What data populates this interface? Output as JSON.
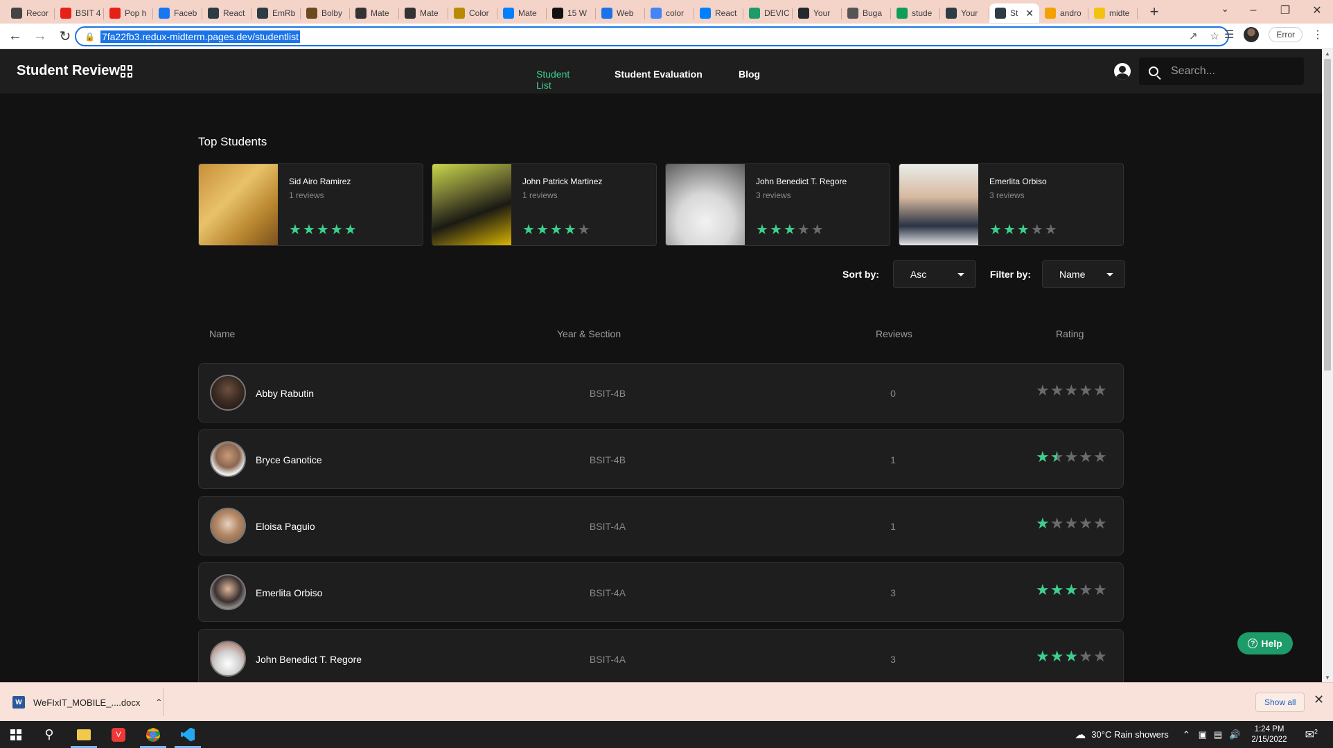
{
  "browser": {
    "tabs": [
      {
        "label": "Recor",
        "color": "#444"
      },
      {
        "label": "BSIT 4",
        "color": "#e62117"
      },
      {
        "label": "Pop h",
        "color": "#e62117"
      },
      {
        "label": "Faceb",
        "color": "#1877f2"
      },
      {
        "label": "React",
        "color": "#2d3b45"
      },
      {
        "label": "EmRb",
        "color": "#2d3b45"
      },
      {
        "label": "Bolby",
        "color": "#6b4a1e"
      },
      {
        "label": "Mate",
        "color": "#333"
      },
      {
        "label": "Mate",
        "color": "#333"
      },
      {
        "label": "Color",
        "color": "#b88a00"
      },
      {
        "label": "Mate",
        "color": "#007fff"
      },
      {
        "label": "15 W",
        "color": "#111"
      },
      {
        "label": "Web",
        "color": "#1a73e8"
      },
      {
        "label": "color",
        "color": "#4285f4"
      },
      {
        "label": "React",
        "color": "#007fff"
      },
      {
        "label": "DEVIC",
        "color": "#1d9c6a"
      },
      {
        "label": "Your",
        "color": "#24292e"
      },
      {
        "label": "Buga",
        "color": "#555"
      },
      {
        "label": "stude",
        "color": "#0f9d58"
      },
      {
        "label": "Your",
        "color": "#2d3b45"
      },
      {
        "label": "St",
        "color": "#2d3b45",
        "active": true
      },
      {
        "label": "andro",
        "color": "#f4a100"
      },
      {
        "label": "midte",
        "color": "#f4c20d"
      }
    ],
    "url": "7fa22fb3.redux-midterm.pages.dev/studentlist",
    "error_label": "Error"
  },
  "header": {
    "brand": "Student Review",
    "nav": [
      {
        "label": "Student List",
        "active": true
      },
      {
        "label": "Student Evaluation"
      },
      {
        "label": "Blog"
      }
    ],
    "search_placeholder": "Search..."
  },
  "top_students": {
    "title": "Top Students",
    "items": [
      {
        "name": "Sid Airo Ramirez",
        "reviews": "1 reviews",
        "rating": 5,
        "photo": "linear-gradient(135deg,#c98f3a 0%,#e8c26a 40%,#b9872f 70%,#7a4f1e 100%)"
      },
      {
        "name": "John Patrick Martinez",
        "reviews": "1 reviews",
        "rating": 4,
        "photo": "linear-gradient(160deg,#c8d84a 0%,#6a6a30 35%,#1a1a14 60%,#e0b800 100%)"
      },
      {
        "name": "John Benedict T. Regore",
        "reviews": "3 reviews",
        "rating": 3,
        "photo": "radial-gradient(circle at 50% 70%,#f2f2f2 0%,#d8d8d8 40%,#9a9a9a 70%,#5c5c5c 100%)"
      },
      {
        "name": "Emerlita Orbiso",
        "reviews": "3 reviews",
        "rating": 3,
        "photo": "linear-gradient(180deg,#e8ece8 0%,#d7b9a0 40%,#2a3344 75%,#f0f0f0 100%)"
      }
    ]
  },
  "controls": {
    "sort_label": "Sort by:",
    "sort_value": "Asc",
    "filter_label": "Filter by:",
    "filter_value": "Name"
  },
  "table": {
    "headers": {
      "name": "Name",
      "section": "Year & Section",
      "reviews": "Reviews",
      "rating": "Rating"
    },
    "rows": [
      {
        "name": "Abby Rabutin",
        "section": "BSIT-4B",
        "reviews": "0",
        "rating": 0,
        "photo": "radial-gradient(circle at 50% 40%,#6e5040 0%,#3a2a22 50%,#1a1410 100%)"
      },
      {
        "name": "Bryce Ganotice",
        "section": "BSIT-4B",
        "reviews": "1",
        "rating": 1.5,
        "photo": "radial-gradient(circle at 50% 40%,#c99a7a 0%,#8a6650 45%,#e8e8e8 70%)"
      },
      {
        "name": "Eloisa Paguio",
        "section": "BSIT-4A",
        "reviews": "1",
        "rating": 1,
        "photo": "radial-gradient(circle at 50% 45%,#e8d2c0 0%,#b48866 45%,#7a5a40 100%)"
      },
      {
        "name": "Emerlita Orbiso",
        "section": "BSIT-4A",
        "reviews": "3",
        "rating": 3,
        "photo": "radial-gradient(circle at 50% 40%,#e0b89a 0%,#3a3030 50%,#e8ece8 100%)"
      },
      {
        "name": "John Benedict T. Regore",
        "section": "BSIT-4A",
        "reviews": "3",
        "rating": 3,
        "photo": "radial-gradient(circle at 50% 65%,#ffffff 0%,#d0d0d0 45%,#a05a4a 100%)"
      }
    ]
  },
  "help_label": "Help",
  "download": {
    "filename": "WeFIxIT_MOBILE_....docx",
    "show_all": "Show all"
  },
  "taskbar": {
    "weather": "30°C  Rain showers",
    "time": "1:24 PM",
    "date": "2/15/2022",
    "notifications": "2"
  },
  "colors": {
    "accent": "#3ecf8e",
    "background": "#121212",
    "surface": "#1e1e1e",
    "star_off": "#6b6b6b"
  }
}
